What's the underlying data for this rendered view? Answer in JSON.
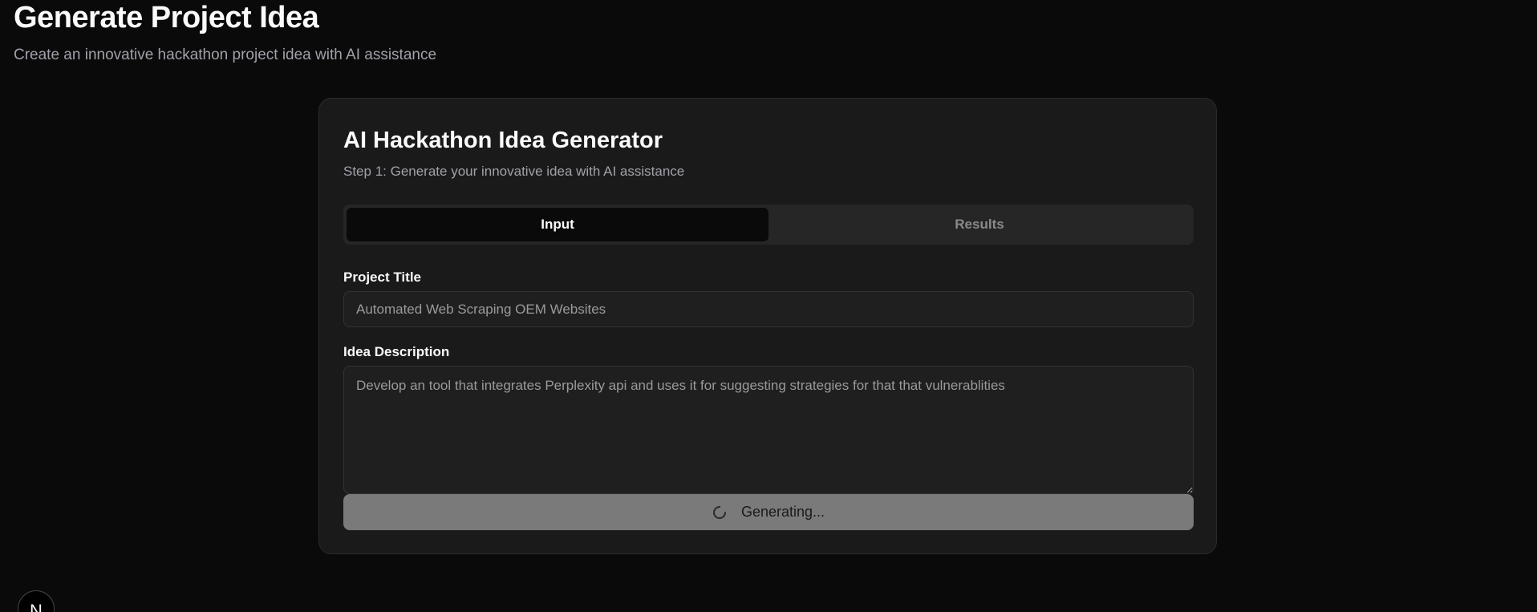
{
  "header": {
    "title": "Generate Project Idea",
    "subtitle": "Create an innovative hackathon project idea with AI assistance"
  },
  "card": {
    "title": "AI Hackathon Idea Generator",
    "subtitle": "Step 1: Generate your innovative idea with AI assistance",
    "tabs": [
      {
        "label": "Input",
        "active": true
      },
      {
        "label": "Results",
        "active": false
      }
    ],
    "form": {
      "project_title_label": "Project Title",
      "project_title_value": "Automated Web Scraping OEM Websites",
      "description_label": "Idea Description",
      "description_value": "Develop an tool that integrates Perplexity api and uses it for suggesting strategies for that that vulnerablities",
      "generate_button_label": "Generating..."
    }
  },
  "badge": {
    "letter": "N"
  },
  "icons": {
    "spinner": "spinner-icon"
  },
  "colors": {
    "background": "#0a0a0a",
    "card": "#1a1a1a",
    "button": "#7a7a7a"
  }
}
